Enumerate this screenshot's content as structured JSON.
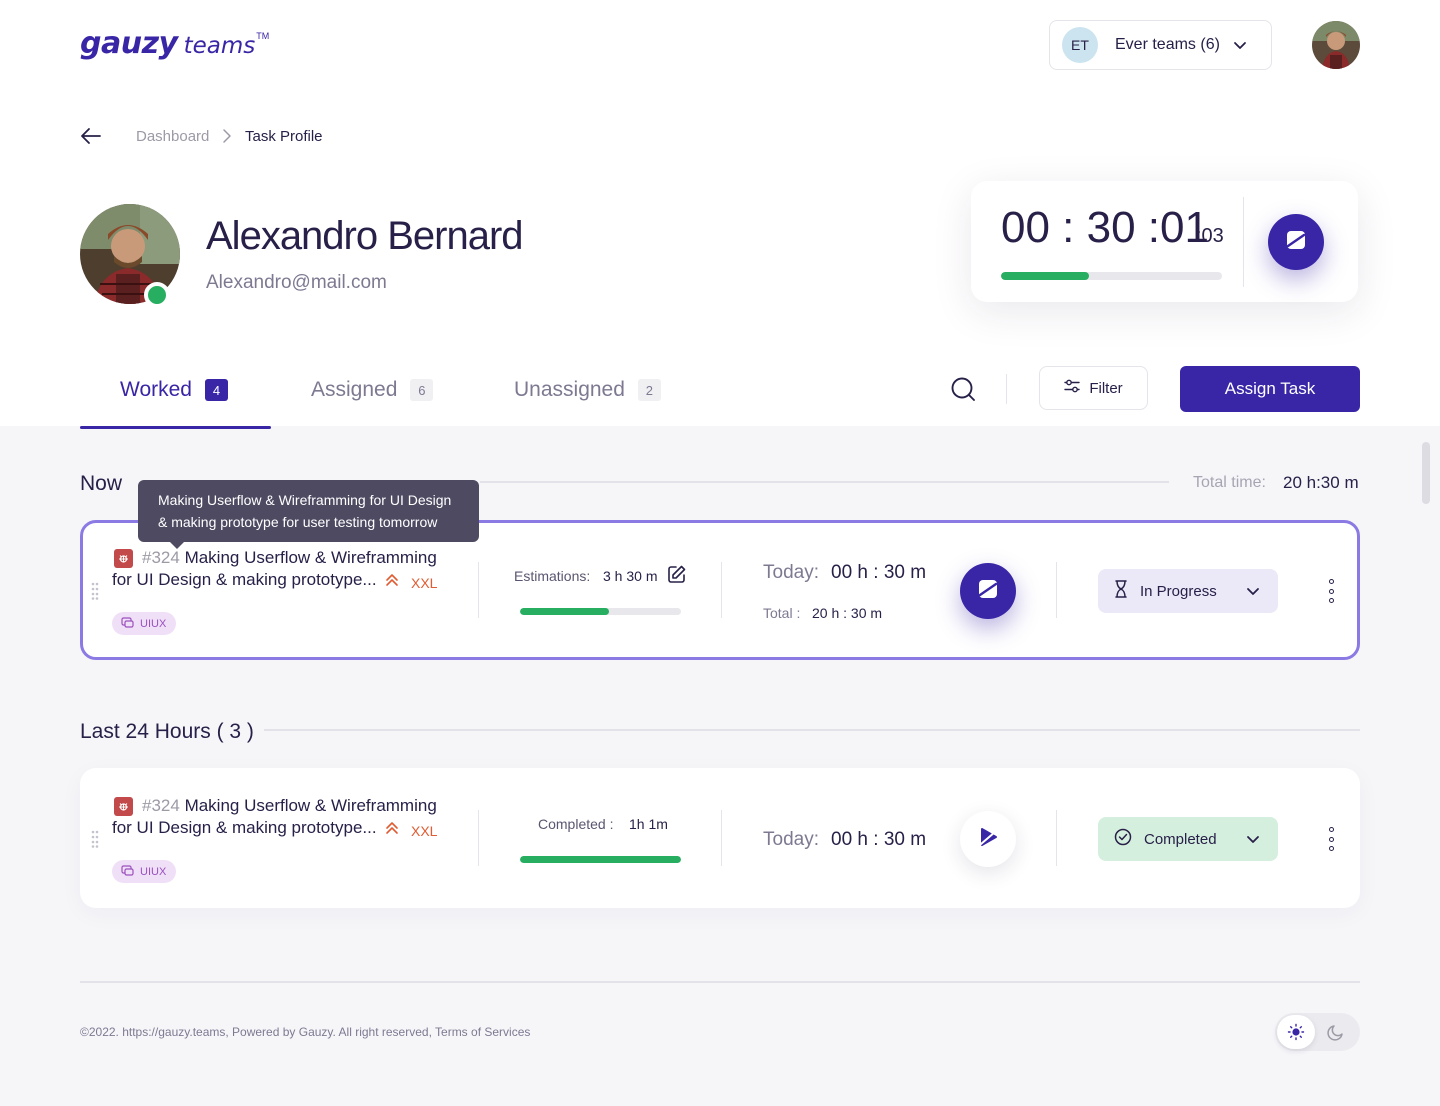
{
  "header": {
    "logo_main": "gauzy",
    "logo_sub": "teams",
    "logo_tm": "TM",
    "team_badge": "ET",
    "team_label": "Ever teams (6)"
  },
  "breadcrumb": {
    "item1": "Dashboard",
    "item2": "Task Profile"
  },
  "profile": {
    "name": "Alexandro Bernard",
    "email": "Alexandro@mail.com",
    "status_color": "#27ae60"
  },
  "timer": {
    "main": "00 : 30 :01",
    "ms": ":03",
    "progress_fraction": 0.4
  },
  "tabs": [
    {
      "label": "Worked",
      "count": "4",
      "active": true
    },
    {
      "label": "Assigned",
      "count": "6"
    },
    {
      "label": "Unassigned",
      "count": "2"
    }
  ],
  "toolbar": {
    "filter_label": "Filter",
    "assign_label": "Assign Task"
  },
  "now_section": {
    "title": "Now",
    "total_label": "Total time:",
    "total_value": "20 h:30 m"
  },
  "tooltip": {
    "line1": "Making Userflow & Wireframming for UI Design",
    "line2": "& making prototype for user testing  tomorrow"
  },
  "active_task": {
    "number": "#324",
    "title": "Making Userflow & Wireframming for UI Design & making prototype...",
    "size": "XXL",
    "tag": "UIUX",
    "estimation_label": "Estimations:",
    "estimation_value": "3 h 30 m",
    "estimation_progress": 0.55,
    "today_label": "Today:",
    "today_value": "00 h : 30 m",
    "total_label": "Total :",
    "total_value": "20 h : 30 m",
    "status": "In Progress"
  },
  "last24_section": {
    "title": "Last 24 Hours ( 3 )"
  },
  "done_task": {
    "number": "#324",
    "title": "Making Userflow & Wireframming for UI Design & making prototype...",
    "size": "XXL",
    "tag": "UIUX",
    "completed_label": "Completed :",
    "completed_value": "1h 1m",
    "completed_progress": 1.0,
    "today_label": "Today:",
    "today_value": "00 h : 30 m",
    "status": "Completed"
  },
  "footer": {
    "text": "©2022. https://gauzy.teams, Powered by Gauzy. All right reserved, Terms of Services"
  },
  "colors": {
    "primary": "#3826a6",
    "success": "#27ae60",
    "priority": "#e05d33",
    "bug": "#c24a4a"
  }
}
